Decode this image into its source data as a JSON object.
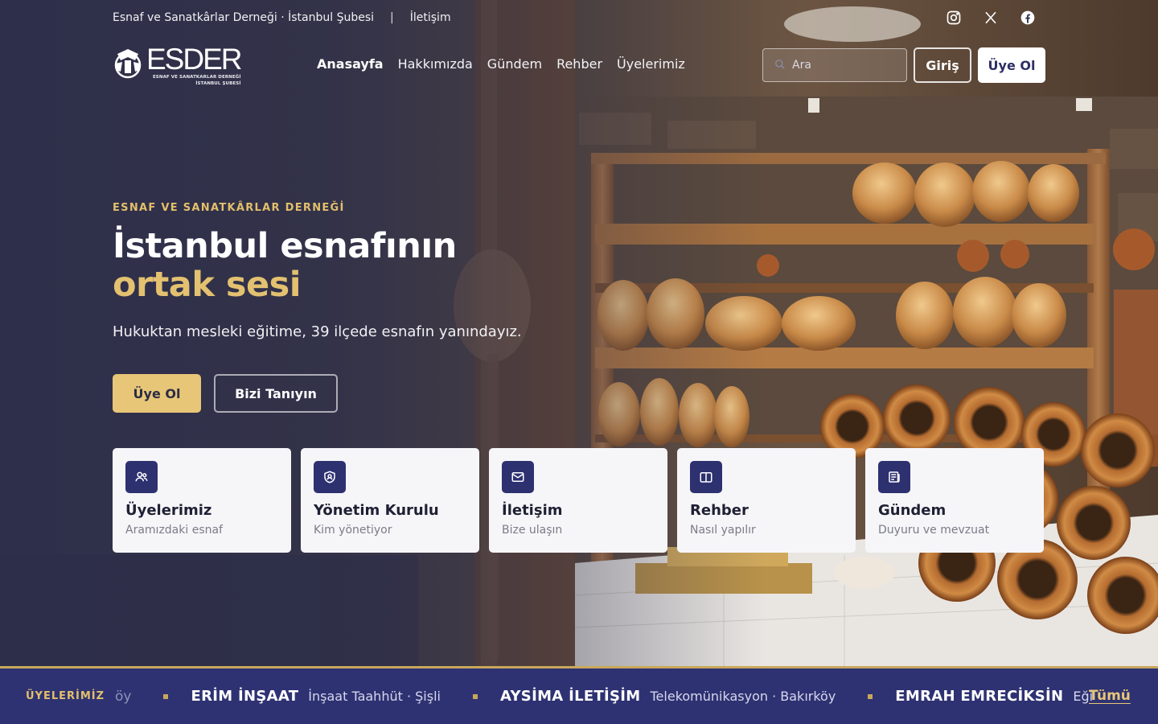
{
  "topbar": {
    "org_name": "Esnaf ve Sanatkârlar Derneği · İstanbul Şubesi",
    "separator": "|",
    "contact_link": "İletişim"
  },
  "social": [
    "instagram-icon",
    "x-icon",
    "facebook-icon"
  ],
  "logo": {
    "main": "ESDER",
    "sub_line1": "ESNAF VE SANATKARLAR DERNEĞİ",
    "sub_line2": "İSTANBUL ŞUBESİ"
  },
  "nav": {
    "items": [
      "Anasayfa",
      "Hakkımızda",
      "Gündem",
      "Rehber",
      "Üyelerimiz"
    ],
    "active": "Anasayfa"
  },
  "search": {
    "placeholder": "Ara"
  },
  "auth": {
    "login_label": "Giriş",
    "join_label": "Üye Ol"
  },
  "hero": {
    "eyebrow": "ESNAF VE SANATKÂRLAR DERNEĞİ",
    "title_line1": "İstanbul esnafının",
    "title_line2": "ortak sesi",
    "subtitle": "Hukuktan mesleki eğitime, 39 ilçede esnafın yanındayız.",
    "primary_cta": "Üye Ol",
    "secondary_cta": "Bizi Tanıyın"
  },
  "cards": [
    {
      "title": "Üyelerimiz",
      "subtitle": "Aramızdaki esnaf",
      "icon": "users-icon"
    },
    {
      "title": "Yönetim Kurulu",
      "subtitle": "Kim yönetiyor",
      "icon": "shield-user-icon"
    },
    {
      "title": "İletişim",
      "subtitle": "Bize ulaşın",
      "icon": "mail-icon"
    },
    {
      "title": "Rehber",
      "subtitle": "Nasıl yapılır",
      "icon": "book-icon"
    },
    {
      "title": "Gündem",
      "subtitle": "Duyuru ve mevzuat",
      "icon": "newspaper-icon"
    }
  ],
  "ticker": {
    "label": "ÜYELERİMİZ",
    "leading_fragment": "öy",
    "items": [
      {
        "name": "ERİM İNŞAAT",
        "desc": "İnşaat Taahhüt · Şişli"
      },
      {
        "name": "AYSİMA İLETİŞİM",
        "desc": "Telekomünikasyon · Bakırköy"
      },
      {
        "name": "EMRAH EMRECİKSİN",
        "desc": "Eği"
      }
    ],
    "all_link": "Tümü"
  },
  "colors": {
    "accent_gold": "#e8c678",
    "navy": "#2d3170",
    "ticker_bg": "#2e3272"
  }
}
